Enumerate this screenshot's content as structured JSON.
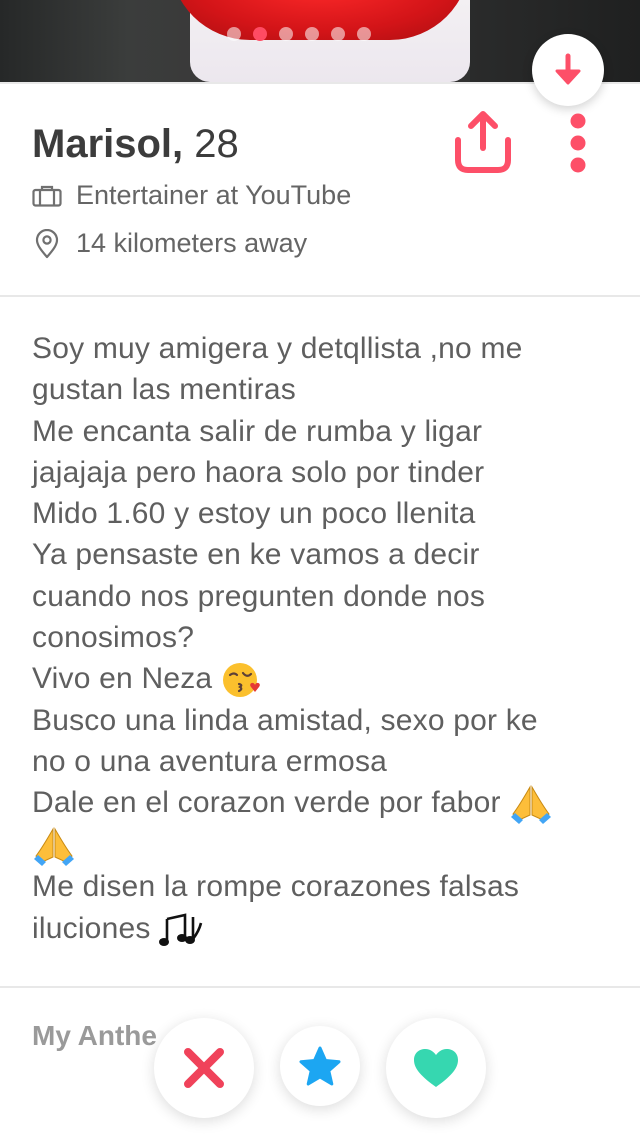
{
  "photo": {
    "dot_count": 6,
    "active_index": 1
  },
  "profile": {
    "name": "Marisol,",
    "age": "28",
    "job": "Entertainer at YouTube",
    "distance": "14 kilometers away"
  },
  "bio": {
    "lines": [
      "Soy muy amigera y detqllista ,no me",
      "gustan las mentiras",
      "Me encanta salir de rumba y ligar",
      "jajajaja pero haora solo por tinder",
      "Mido 1.60 y estoy un poco llenita",
      "Ya pensaste en ke vamos a decir",
      "cuando nos pregunten donde nos",
      "conosimos?",
      "Vivo en Neza",
      "Busco una linda amistad, sexo por ke",
      "no o una aventura ermosa",
      "Dale en el corazon verde por fabor",
      "",
      "Me disen la rompe corazones falsas",
      "iluciones"
    ]
  },
  "anthem": {
    "label": "My Anthe"
  },
  "icons": {
    "collapse": "arrow-down-icon",
    "share": "share-icon",
    "more": "more-vertical-icon",
    "job": "briefcase-icon",
    "location": "location-pin-icon",
    "nope": "close-icon",
    "superlike": "star-icon",
    "like": "heart-icon"
  },
  "colors": {
    "brand": "#fd4f68",
    "nope": "#f0425a",
    "superlike": "#1ca6f2",
    "like": "#36d7b0",
    "text": "#5f5f5f"
  }
}
